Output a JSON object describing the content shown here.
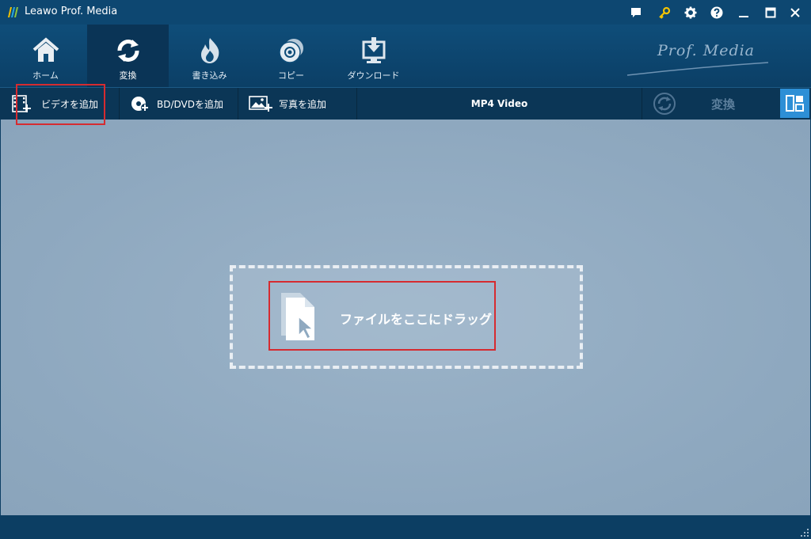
{
  "window": {
    "title": "Leawo Prof. Media"
  },
  "titlebar_icons": [
    "feedback-icon",
    "key-icon",
    "gear-icon",
    "help-icon",
    "minimize-icon",
    "maximize-icon",
    "close-icon"
  ],
  "nav": {
    "tabs": [
      {
        "label": "ホーム",
        "icon": "home-icon",
        "active": false
      },
      {
        "label": "変換",
        "icon": "convert-icon",
        "active": true
      },
      {
        "label": "書き込み",
        "icon": "burn-icon",
        "active": false
      },
      {
        "label": "コピー",
        "icon": "copy-icon",
        "active": false
      },
      {
        "label": "ダウンロード",
        "icon": "download-icon",
        "active": false
      }
    ],
    "brand": "Prof. Media"
  },
  "toolbar": {
    "add_video": "ビデオを追加",
    "add_bd_dvd": "BD/DVDを追加",
    "add_photo": "写真を追加",
    "format": "MP4 Video",
    "convert": "変換"
  },
  "dropzone": {
    "text": "ファイルをここにドラッグ"
  },
  "colors": {
    "titlebar": "#0d4771",
    "toolbar": "#0b3656",
    "main_bg": "#8ea8bf",
    "accent": "#2d8fd6",
    "highlight": "#d62b30",
    "key_icon": "#f5c400"
  }
}
